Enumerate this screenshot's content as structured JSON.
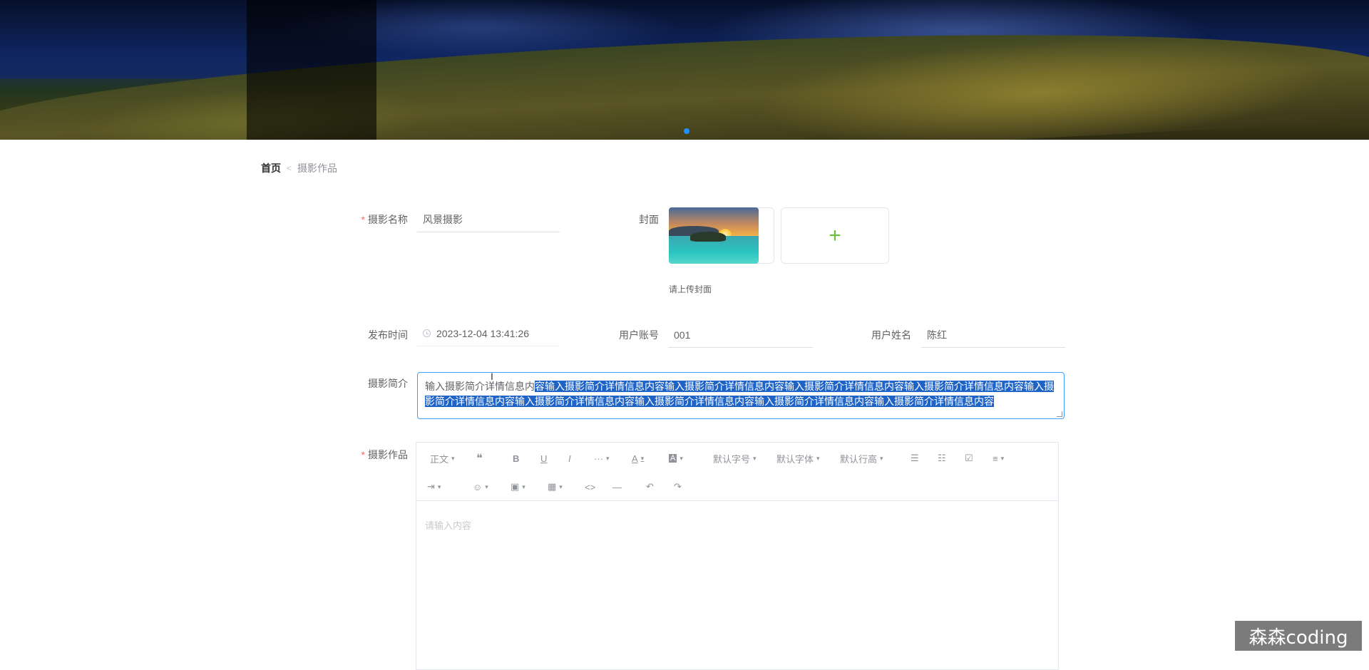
{
  "banner": {
    "active_slide_index": 0
  },
  "breadcrumb": {
    "home": "首页",
    "separator": "<",
    "current": "摄影作品"
  },
  "form": {
    "name": {
      "label": "摄影名称",
      "value": "风景摄影",
      "required": true
    },
    "cover": {
      "label": "封面",
      "upload_symbol": "+",
      "hint": "请上传封面"
    },
    "publish_time": {
      "label": "发布时间",
      "value": "2023-12-04 13:41:26",
      "icon": "clock-icon"
    },
    "user_account": {
      "label": "用户账号",
      "value": "001"
    },
    "user_name": {
      "label": "用户姓名",
      "value": "陈红"
    },
    "intro": {
      "label": "摄影简介",
      "unselected_text": "输入摄影简介详情信息内",
      "selected_text": "容输入摄影简介详情信息内容输入摄影简介详情信息内容输入摄影简介详情信息内容输入摄影简介详情信息内容输入摄影简介详情信息内容输入摄影简介详情信息内容输入摄影简介详情信息内容输入摄影简介详情信息内容输入摄影简介详情信息内容"
    },
    "works": {
      "label": "摄影作品",
      "required": true,
      "placeholder": "请输入内容"
    }
  },
  "editor_toolbar": {
    "paragraph": "正文",
    "quote": "❝",
    "bold": "B",
    "underline": "U",
    "italic": "I",
    "more": "···",
    "font_color": "A",
    "bg_color": "A",
    "font_size": "默认字号",
    "font_family": "默认字体",
    "line_height": "默认行高",
    "bullet_list": "☰",
    "numbered_list": "☷",
    "todo": "☑",
    "align": "≡",
    "indent": "⇥",
    "emoji": "☺",
    "image": "▣",
    "table": "▦",
    "code": "<>",
    "divider": "—",
    "undo": "↶",
    "redo": "↷"
  },
  "watermark": {
    "text": "森森coding"
  }
}
